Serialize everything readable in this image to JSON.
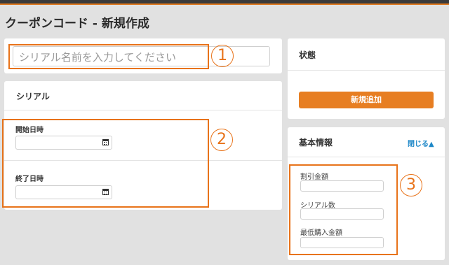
{
  "header": {
    "title": "クーポンコード - 新規作成"
  },
  "name_card": {
    "placeholder": "シリアル名前を入力してください"
  },
  "serial_card": {
    "title": "シリアル",
    "start_label": "開始日時",
    "end_label": "終了日時"
  },
  "status_card": {
    "title": "状態",
    "add_button": "新規追加"
  },
  "basic_info_card": {
    "title": "基本情報",
    "toggle_label": "閉じる▲",
    "fields": [
      {
        "label": "割引金額"
      },
      {
        "label": "シリアル数"
      },
      {
        "label": "最低購入金額"
      }
    ]
  },
  "callouts": [
    "1",
    "2",
    "3"
  ],
  "colors": {
    "accent": "#e8731a",
    "button": "#e77e22",
    "link": "#1e88c8",
    "background": "#e1e1e1"
  },
  "icons": [
    "calendar-icon",
    "calendar-icon"
  ]
}
